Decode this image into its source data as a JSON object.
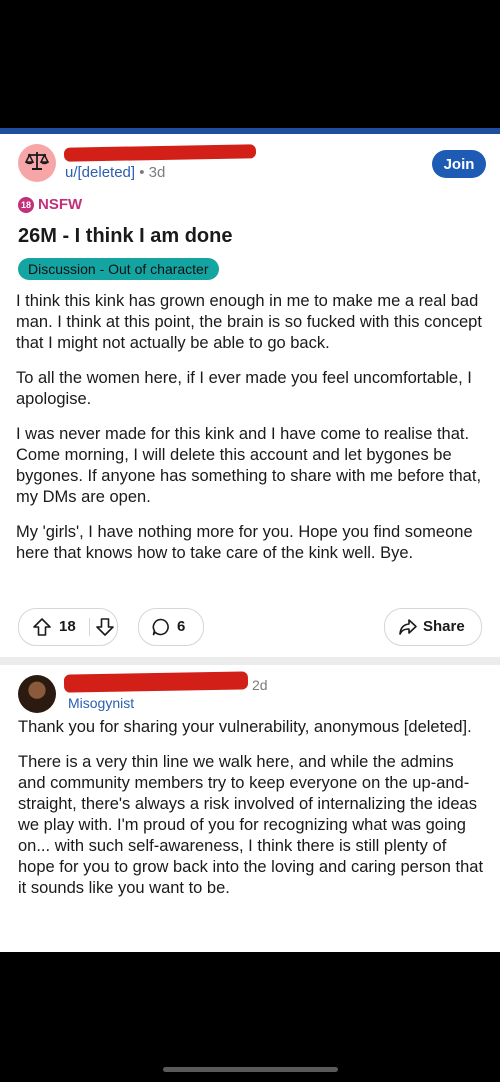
{
  "post": {
    "username": "u/[deleted]",
    "separator": "•",
    "age": "3d",
    "join_label": "Join",
    "nsfw_badge": "18",
    "nsfw_label": "NSFW",
    "title": "26M - I think I am done",
    "flair": "Discussion - Out of character",
    "body": [
      "I think this kink has grown enough in me to make me a real bad man. I think at this point, the brain is so fucked with this concept that I might not actually be able to go back.",
      "To all the women here, if I ever made you feel uncomfortable, I apologise.",
      "I was never made for this kink and I have come to realise that. Come morning, I will delete this account and let bygones be bygones. If anyone has something to share with me before that, my DMs are open.",
      "My 'girls', I have nothing more for you. Hope you find someone here that knows how to take care of the kink well. Bye."
    ],
    "upvotes": "18",
    "comments": "6",
    "share_label": "Share"
  },
  "comment": {
    "flair": "Misogynist",
    "age": "2d",
    "body": [
      "Thank you for sharing your vulnerability, anonymous [deleted].",
      "There is a very thin line we walk here, and while the admins and community members try to keep everyone on the up-and-straight, there's always a risk involved of internalizing the ideas we play with. I'm proud of you for recognizing what was going on... with such self-awareness, I think there is still plenty of hope for you to grow back into the loving and caring person that it sounds like you want to be."
    ]
  },
  "colors": {
    "accent_blue": "#1d5bb4",
    "nsfw_pink": "#c42f7a",
    "flair_teal": "#14a5a3",
    "redaction_red": "#d22018"
  },
  "icons": [
    "scale-icon",
    "upvote-icon",
    "downvote-icon",
    "comment-icon",
    "share-icon"
  ]
}
